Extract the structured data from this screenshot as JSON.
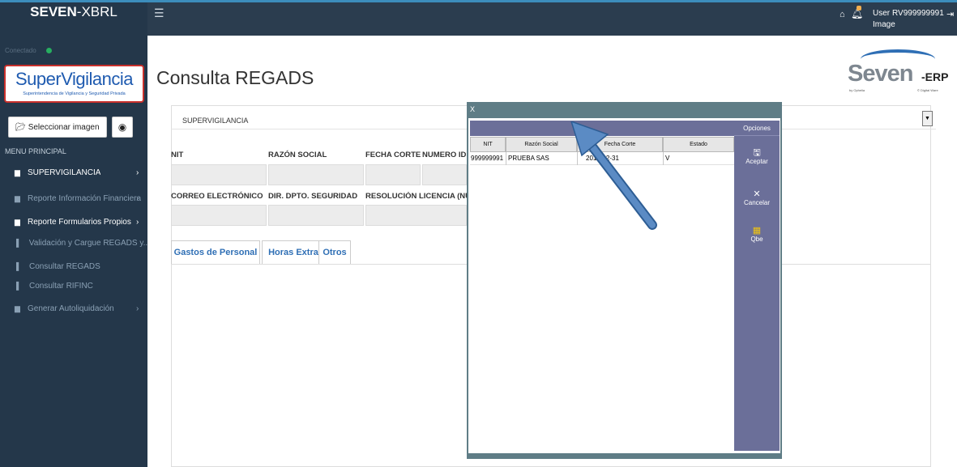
{
  "topbar": {
    "brand_bold": "SEVEN",
    "brand_light": "-XBRL",
    "menu_icon": "hamburger-icon",
    "home_icon": "home-icon",
    "bell_icon": "bell-icon",
    "user_label": "User",
    "user_id": "RV999999991",
    "image_label": "Image",
    "logout_icon": "logout-icon"
  },
  "sidebar": {
    "online_text": "Conectado",
    "logo_text": "SuperVigilancia",
    "logo_subtext": "Superintendencia de Vigilancia y Seguridad Privada",
    "select_image_button": "Seleccionar imagen",
    "menu_header": "MENU PRINCIPAL",
    "items": [
      {
        "label": "SUPERVIGILANCIA",
        "icon": "folder-icon",
        "arrow": "›",
        "state": "active"
      },
      {
        "label": "Reporte Información Financiera",
        "icon": "folder-icon",
        "arrow": "›",
        "state": "dim"
      },
      {
        "label": "Reporte Formularios Propios",
        "icon": "folder-icon",
        "arrow": "›",
        "state": "active"
      },
      {
        "label": "Validación y Cargue REGADS y...",
        "icon": "file-icon",
        "arrow": "",
        "state": "dim"
      },
      {
        "label": "Consultar REGADS",
        "icon": "file-icon",
        "arrow": "",
        "state": "dim"
      },
      {
        "label": "Consultar RIFINC",
        "icon": "file-icon",
        "arrow": "",
        "state": "dim"
      },
      {
        "label": "Generar Autoliquidación",
        "icon": "folder-icon",
        "arrow": "›",
        "state": "dim"
      }
    ]
  },
  "main": {
    "title": "Consulta REGADS",
    "logo": {
      "word": "Seven",
      "suffix": "-ERP",
      "by": "by Ophelia",
      "company": "© Digital Ware"
    },
    "entity_select": "SUPERVIGILANCIA",
    "fields_row1": [
      "NIT",
      "RAZÓN SOCIAL",
      "FECHA CORTE",
      "NUMERO IDE"
    ],
    "fields_row2": [
      "CORREO ELECTRÓNICO",
      "DIR. DPTO. SEGURIDAD",
      "RESOLUCIÓN LICENCIA (NÚMI"
    ],
    "tabs": [
      "Gastos de Personal",
      "Horas Extra",
      "Otros"
    ]
  },
  "modal": {
    "title": "X",
    "columns": [
      "NIT",
      "Razón Social",
      "Fecha Corte",
      "Estado"
    ],
    "rows": [
      {
        "nit": "999999991",
        "razon": "PRUEBA SAS",
        "fecha": "2018-12-31",
        "estado": "V"
      }
    ],
    "options_title": "Opciones",
    "options": [
      {
        "label": "Aceptar",
        "icon": "save-icon"
      },
      {
        "label": "Cancelar",
        "icon": "close-icon"
      },
      {
        "label": "Qbe",
        "icon": "query-icon"
      }
    ]
  },
  "colors": {
    "topbar": "#2b3d4f",
    "sidebar": "#24374a",
    "modal_header": "#6b6f99",
    "modal_frame": "#5f7d86",
    "tab_text": "#2f6fb5",
    "annotation_arrow": "#5b8bc4"
  }
}
